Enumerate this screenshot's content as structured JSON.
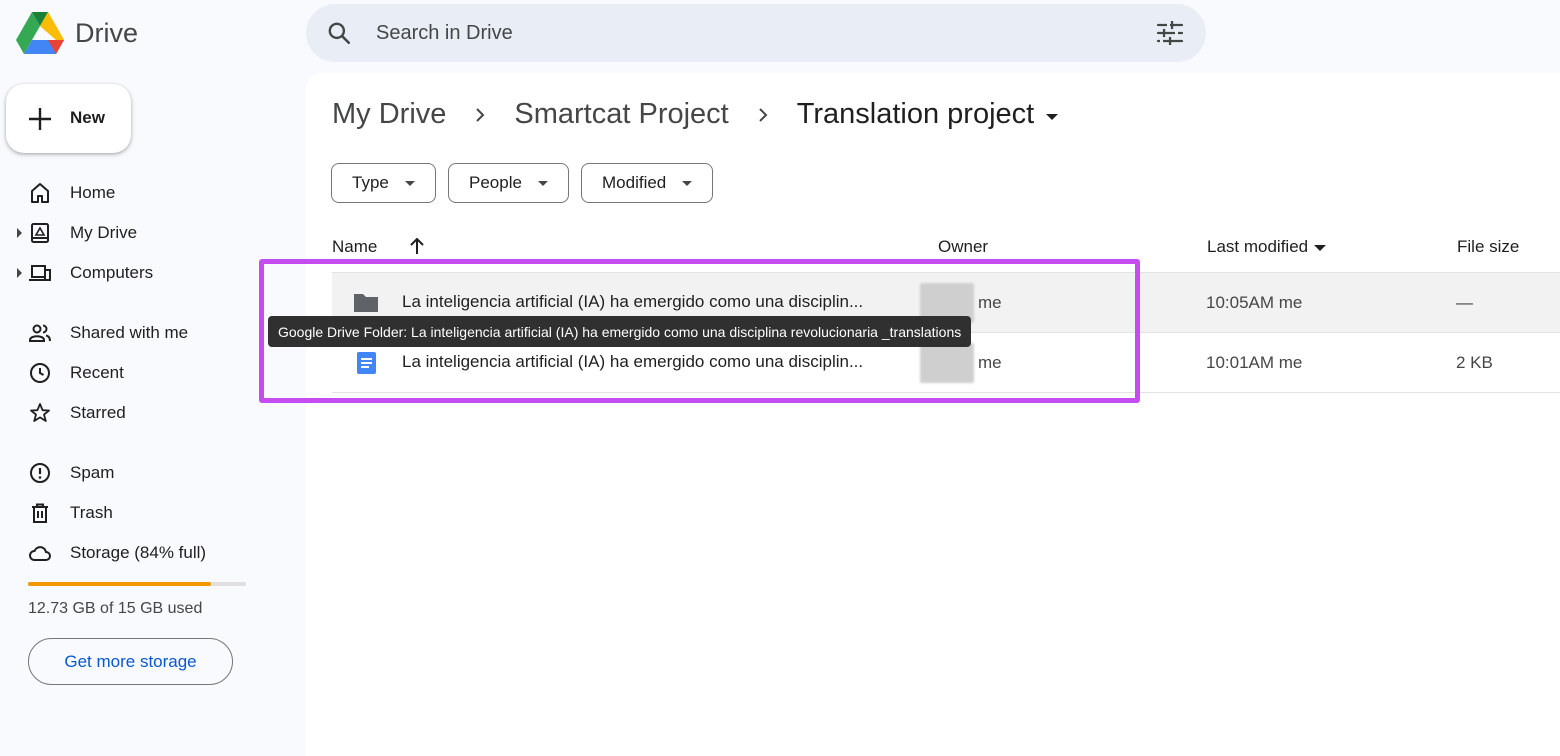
{
  "app": {
    "name": "Drive",
    "colors": {
      "accent": "#0b57d0",
      "highlight": "#c54cf0",
      "storage": "#f29900"
    }
  },
  "search": {
    "placeholder": "Search in Drive"
  },
  "sidebar": {
    "new_label": "New",
    "items": [
      {
        "label": "Home",
        "icon": "home-icon"
      },
      {
        "label": "My Drive",
        "icon": "my-drive-icon"
      },
      {
        "label": "Computers",
        "icon": "computers-icon"
      },
      {
        "label": "Shared with me",
        "icon": "shared-icon"
      },
      {
        "label": "Recent",
        "icon": "clock-icon"
      },
      {
        "label": "Starred",
        "icon": "star-icon"
      },
      {
        "label": "Spam",
        "icon": "spam-icon"
      },
      {
        "label": "Trash",
        "icon": "trash-icon"
      },
      {
        "label": "Storage (84% full)",
        "icon": "cloud-icon"
      }
    ],
    "storage": {
      "used_fraction": 0.84,
      "used_text": "12.73 GB of 15 GB used",
      "button_label": "Get more storage"
    }
  },
  "breadcrumb": [
    "My Drive",
    "Smartcat Project",
    "Translation project"
  ],
  "filters": [
    "Type",
    "People",
    "Modified"
  ],
  "columns": {
    "name": "Name",
    "owner": "Owner",
    "modified": "Last modified",
    "size": "File size"
  },
  "files": [
    {
      "type": "folder-icon",
      "name": "La inteligencia artificial (IA) ha emergido como una disciplin...",
      "owner": "me",
      "modified": "10:05AM me",
      "size": "—"
    },
    {
      "type": "doc-icon",
      "name": "La inteligencia artificial (IA) ha emergido como una disciplin...",
      "owner": "me",
      "modified": "10:01AM me",
      "size": "2 KB"
    }
  ],
  "tooltip": "Google Drive Folder: La inteligencia artificial (IA) ha emergido como una disciplina revolucionaria _translations"
}
